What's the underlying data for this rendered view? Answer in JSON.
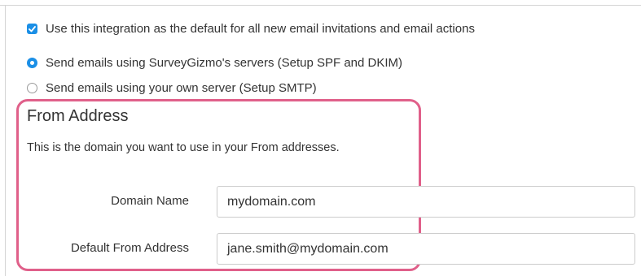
{
  "options": {
    "default_checkbox_label": "Use this integration as the default for all new email invitations and email actions",
    "default_checked": true,
    "send_options": [
      {
        "label": "Send emails using SurveyGizmo's servers (Setup SPF and DKIM)",
        "selected": true
      },
      {
        "label": "Send emails using your own server (Setup SMTP)",
        "selected": false
      }
    ]
  },
  "from_address": {
    "title": "From Address",
    "description": "This is the domain you want to use in your From addresses.",
    "domain_label": "Domain Name",
    "domain_value": "mydomain.com",
    "default_from_label": "Default From Address",
    "default_from_value": "jane.smith@mydomain.com"
  },
  "colors": {
    "accent": "#1b8fe6",
    "highlight": "#e0608a"
  }
}
